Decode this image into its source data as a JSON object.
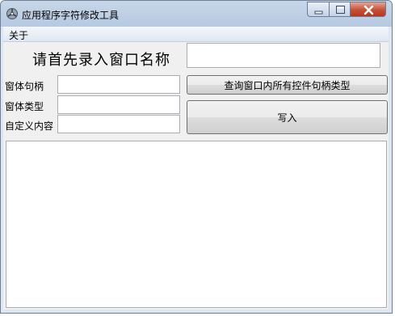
{
  "window": {
    "title": "应用程序字符修改工具",
    "icon": "gear-app-icon",
    "controls": {
      "minimize": "minimize-icon",
      "maximize": "maximize-icon",
      "close": "close-icon"
    }
  },
  "menu": {
    "items": [
      {
        "label": "关于"
      }
    ]
  },
  "form": {
    "prompt_label": "请首先录入窗口名称",
    "window_name_value": "",
    "handle_label": "窗体句柄",
    "handle_value": "",
    "type_label": "窗体类型",
    "type_value": "",
    "custom_label": "自定义内容",
    "custom_value": "",
    "query_button": "查询窗口内所有控件句柄类型",
    "write_button": "写入",
    "output_text": ""
  }
}
